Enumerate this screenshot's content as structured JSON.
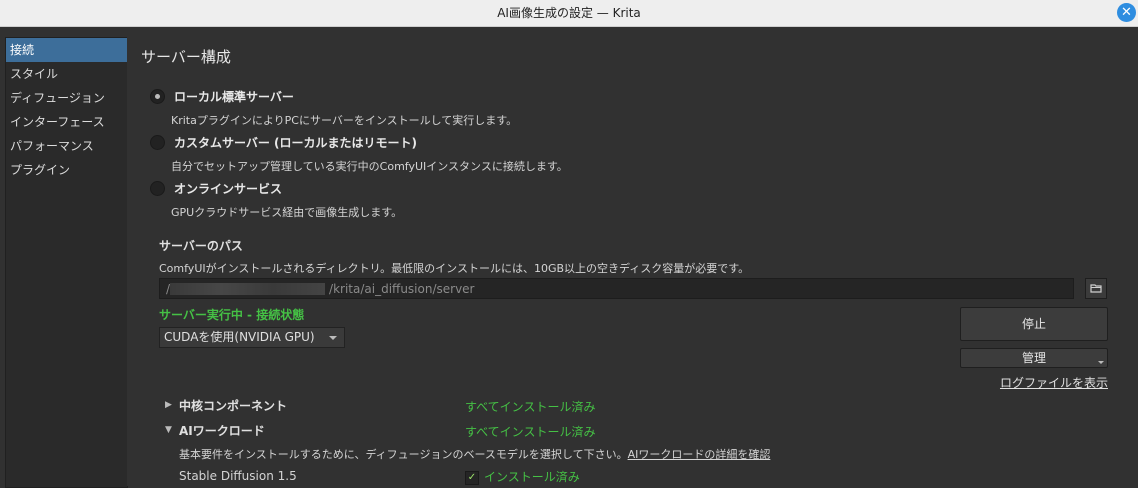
{
  "window": {
    "title": "AI画像生成の設定 — Krita"
  },
  "sidebar": {
    "items": [
      {
        "label": "接続"
      },
      {
        "label": "スタイル"
      },
      {
        "label": "ディフュージョン"
      },
      {
        "label": "インターフェース"
      },
      {
        "label": "パフォーマンス"
      },
      {
        "label": "プラグイン"
      }
    ],
    "active_index": 0
  },
  "main": {
    "heading": "サーバー構成",
    "options": [
      {
        "label": "ローカル標準サーバー",
        "description": "KritaプラグインによりPCにサーバーをインストールして実行します。",
        "checked": true
      },
      {
        "label": "カスタムサーバー (ローカルまたはリモート)",
        "description": "自分でセットアップ管理している実行中のComfyUIインスタンスに接続します。",
        "checked": false
      },
      {
        "label": "オンラインサービス",
        "description": "GPUクラウドサービス経由で画像生成します。",
        "checked": false
      }
    ],
    "server_path": {
      "label": "サーバーのパス",
      "description": "ComfyUIがインストールされるディレクトリ。最低限のインストールには、10GB以上の空きディスク容量が必要です。",
      "value_prefix": "/",
      "value_suffix": "/krita/ai_diffusion/server"
    },
    "status": "サーバー実行中 - 接続状態",
    "backend_select": "CUDAを使用(NVIDIA GPU)",
    "stop_button": "停止",
    "manage_button": "管理",
    "log_link": "ログファイルを表示",
    "components": {
      "core_label": "中核コンポーネント",
      "core_status": "すべてインストール済み",
      "workload_label": "AIワークロード",
      "workload_status": "すべてインストール済み",
      "workload_desc": "基本要件をインストールするために、ディフュージョンのベースモデルを選択して下さい。",
      "workload_link": "AIワークロードの詳細を確認",
      "sd_label": "Stable Diffusion 1.5",
      "sd_status": "インストール済み"
    }
  }
}
